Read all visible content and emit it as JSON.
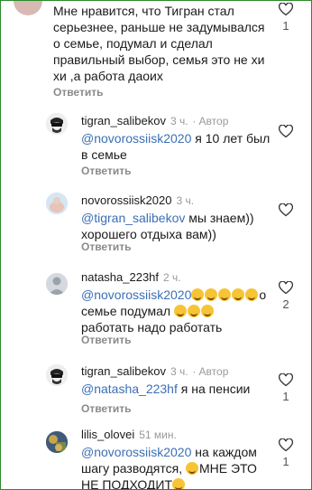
{
  "comments": [
    {
      "text": "Мне нравится, что Тигран стал серьезнее, раньше не задумывался о семье, подумал и сделал правильный выбор, семья это не хи хи ,а работа даоих",
      "reply_label": "Ответить",
      "likes": "1"
    },
    {
      "username": "tigran_salibekov",
      "time": "3 ч.",
      "author_badge": "Автор",
      "mention": "@novorossiisk2020",
      "text": " я 10 лет был в семье",
      "reply_label": "Ответить"
    },
    {
      "username": "novorossiisk2020",
      "time": "3 ч.",
      "mention": "@tigran_salibekov",
      "text": " мы знаем)) хорошего отдыха вам))",
      "reply_label": "Ответить"
    },
    {
      "username": "natasha_223hf",
      "time": "2 ч.",
      "mention": "@novorossiisk2020",
      "text_after_emoji": "о семье подумал",
      "text_tail": "работать надо работать",
      "reply_label": "Ответить",
      "likes": "2"
    },
    {
      "username": "tigran_salibekov",
      "time": "3 ч.",
      "author_badge": "Автор",
      "mention": "@natasha_223hf",
      "text": " я на пенсии",
      "reply_label": "Ответить",
      "likes": "1"
    },
    {
      "username": "lilis_olovei",
      "time": "51 мин.",
      "mention": "@novorossiisk2020",
      "text": " на каждом шагу разводятся, ",
      "text_tail": "МНЕ ЭТО НЕ ПОДХОДИТ",
      "likes": "1"
    }
  ],
  "icons": {
    "like": "heart-outline-icon"
  },
  "colors": {
    "mention": "#3b6fb6",
    "frame_border": "#2a8a2a"
  }
}
